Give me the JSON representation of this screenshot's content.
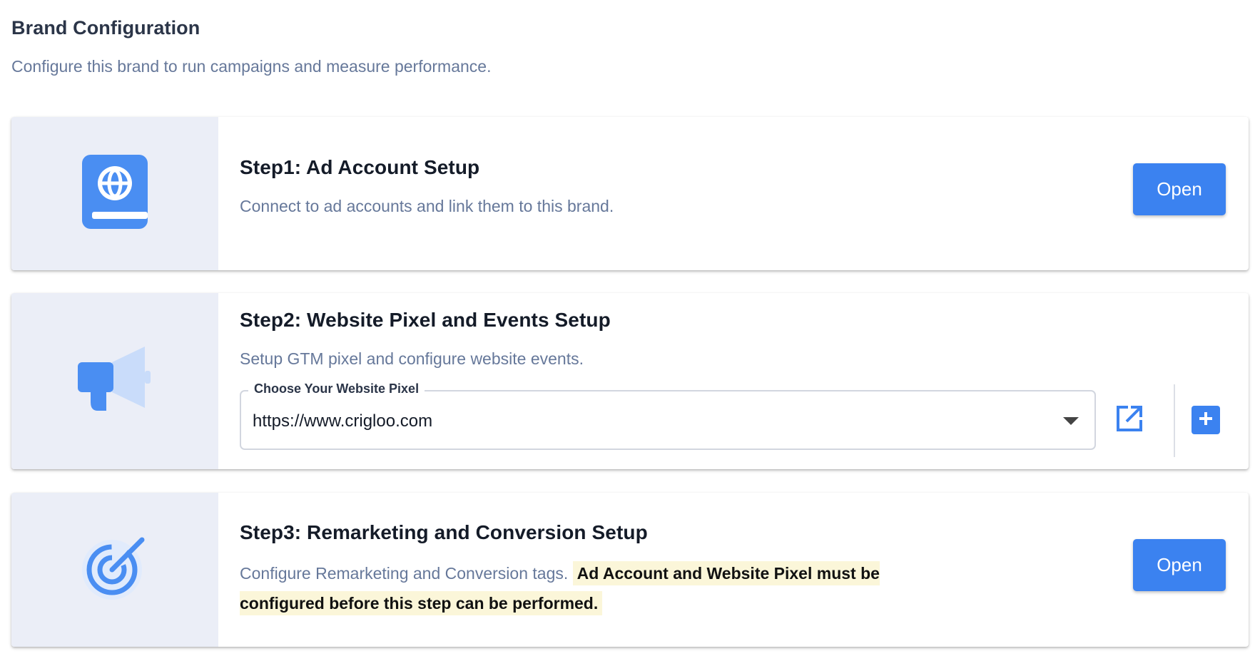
{
  "header": {
    "title": "Brand Configuration",
    "subtitle": "Configure this brand to run campaigns and measure performance."
  },
  "steps": [
    {
      "icon": "book-globe-icon",
      "title": "Step1: Ad Account Setup",
      "description": "Connect to ad accounts and link them to this brand.",
      "button_label": "Open"
    },
    {
      "icon": "megaphone-icon",
      "title": "Step2: Website Pixel and Events Setup",
      "description": "Setup GTM pixel and configure website events.",
      "select": {
        "label": "Choose Your Website Pixel",
        "value": "https://www.crigloo.com"
      },
      "edit_icon": "open-in-new-icon",
      "add_icon": "plus-box-icon"
    },
    {
      "icon": "target-icon",
      "title": "Step3: Remarketing and Conversion Setup",
      "description": "Configure Remarketing and Conversion tags.",
      "warning": "Ad Account and Website Pixel must be configured before this step can be performed.",
      "button_label": "Open"
    }
  ],
  "colors": {
    "accent": "#3b82f0",
    "icon_panel_bg": "#ebeef7",
    "highlight_bg": "#fbf6d9",
    "muted_text": "#66789a"
  }
}
